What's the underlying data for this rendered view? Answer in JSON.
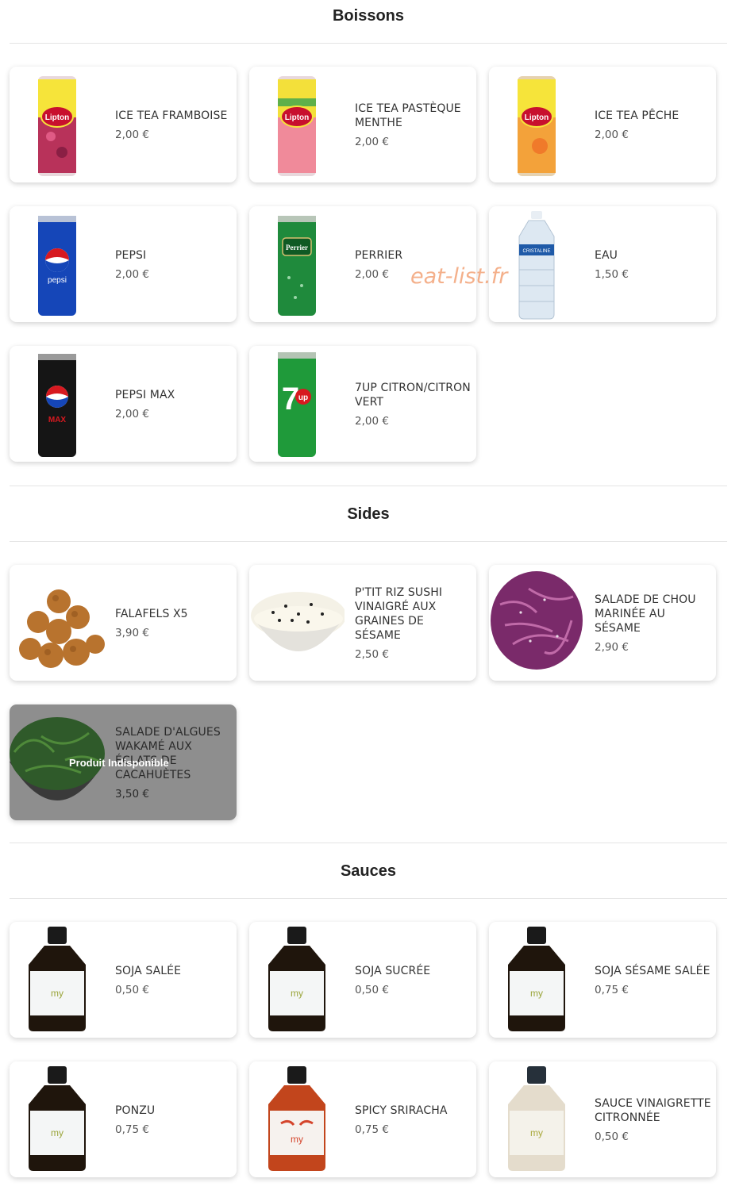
{
  "watermark": "eat-list.fr",
  "colors": {
    "card_bg": "#ffffff",
    "unavailable_bg": "#8e8e8e",
    "rule": "#e4e4e4",
    "watermark": "#f0966a"
  },
  "sections": [
    {
      "title": "Boissons",
      "items": [
        {
          "name": "ICE TEA FRAMBOISE",
          "price": "2,00 €",
          "image": "lipton-can-raspberry"
        },
        {
          "name": "ICE TEA PASTÈQUE MENTHE",
          "price": "2,00 €",
          "image": "lipton-can-watermelon"
        },
        {
          "name": "ICE TEA PÊCHE",
          "price": "2,00 €",
          "image": "lipton-can-peach"
        },
        {
          "name": "PEPSI",
          "price": "2,00 €",
          "image": "pepsi-can"
        },
        {
          "name": "PERRIER",
          "price": "2,00 €",
          "image": "perrier-can"
        },
        {
          "name": "EAU",
          "price": "1,50 €",
          "image": "water-bottle"
        },
        {
          "name": "PEPSI MAX",
          "price": "2,00 €",
          "image": "pepsi-max-can"
        },
        {
          "name": "7UP CITRON/CITRON VERT",
          "price": "2,00 €",
          "image": "7up-can"
        }
      ]
    },
    {
      "title": "Sides",
      "items": [
        {
          "name": "FALAFELS X5",
          "price": "3,90 €",
          "image": "falafels"
        },
        {
          "name": "P'TIT RIZ SUSHI VINAIGRÉ AUX GRAINES DE SÉSAME",
          "price": "2,50 €",
          "image": "rice-bowl"
        },
        {
          "name": "SALADE DE CHOU MARINÉE AU SÉSAME",
          "price": "2,90 €",
          "image": "red-cabbage-salad"
        },
        {
          "name": "SALADE D'ALGUES WAKAMÉ AUX ÉCLATS DE CACAHUÈTES",
          "price": "3,50 €",
          "image": "wakame-bowl",
          "unavailable": true,
          "unavailable_label": "Produit Indisponible"
        }
      ]
    },
    {
      "title": "Sauces",
      "items": [
        {
          "name": "SOJA SALÉE",
          "price": "0,50 €",
          "image": "soy-bottle"
        },
        {
          "name": "SOJA SUCRÉE",
          "price": "0,50 €",
          "image": "soy-bottle"
        },
        {
          "name": "SOJA SÉSAME SALÉE",
          "price": "0,75 €",
          "image": "soy-bottle"
        },
        {
          "name": "PONZU",
          "price": "0,75 €",
          "image": "soy-bottle"
        },
        {
          "name": "SPICY SRIRACHA",
          "price": "0,75 €",
          "image": "sriracha-bottle"
        },
        {
          "name": "SAUCE VINAIGRETTE CITRONNÉE",
          "price": "0,50 €",
          "image": "vinaigrette-bottle"
        }
      ]
    }
  ]
}
